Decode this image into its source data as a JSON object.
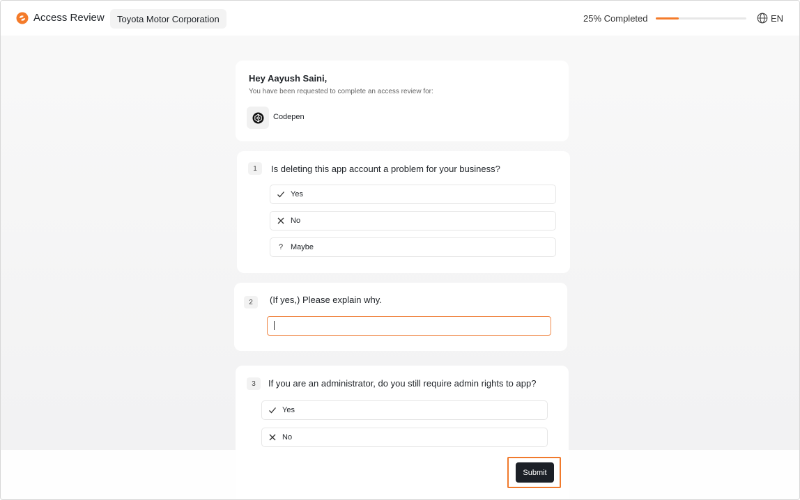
{
  "header": {
    "app_title": "Access Review",
    "organization": "Toyota Motor Corporation",
    "progress_text": "25% Completed",
    "progress_value": 0.25,
    "language": "EN",
    "accent_color": "#f47b2a"
  },
  "intro": {
    "greeting": "Hey Aayush Saini,",
    "message": "You have been requested to complete an access review for:",
    "app_name": "Codepen",
    "app_icon": "codepen-icon"
  },
  "questions": [
    {
      "number": "1",
      "text": "Is deleting this app account a problem for your business?",
      "options": [
        {
          "icon": "check-icon",
          "label": "Yes"
        },
        {
          "icon": "x-icon",
          "label": "No"
        },
        {
          "icon": "question-icon",
          "label": "Maybe"
        }
      ]
    },
    {
      "number": "2",
      "text": "(If yes,) Please explain why.",
      "input_value": ""
    },
    {
      "number": "3",
      "text": "If you are an administrator, do you still require admin rights to app?",
      "options": [
        {
          "icon": "check-icon",
          "label": "Yes"
        },
        {
          "icon": "x-icon",
          "label": "No"
        }
      ]
    }
  ],
  "footer": {
    "submit_label": "Submit",
    "submit_color": "#1c2027",
    "highlight_color": "#f07a2c"
  }
}
